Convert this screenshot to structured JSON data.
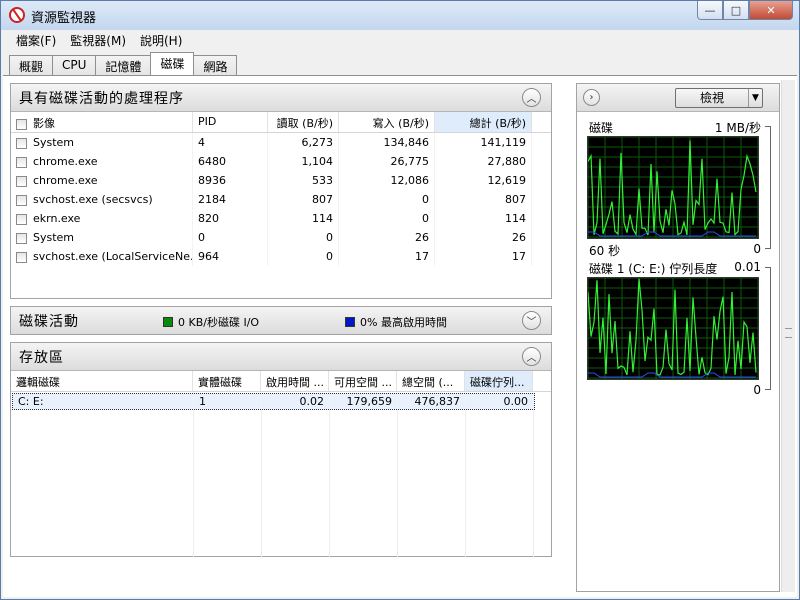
{
  "window": {
    "title": "資源監視器",
    "controls": {
      "minimize": "—",
      "maximize": "□",
      "close": "✕"
    }
  },
  "menu": [
    "檔案(F)",
    "監視器(M)",
    "說明(H)"
  ],
  "tabs": [
    "概觀",
    "CPU",
    "記憶體",
    "磁碟",
    "網路"
  ],
  "active_tab": 3,
  "processes": {
    "title": "具有磁碟活動的處理程序",
    "columns": [
      "影像",
      "PID",
      "讀取 (B/秒)",
      "寫入 (B/秒)",
      "總計 (B/秒)"
    ],
    "rows": [
      [
        "System",
        "4",
        "6,273",
        "134,846",
        "141,119"
      ],
      [
        "chrome.exe",
        "6480",
        "1,104",
        "26,775",
        "27,880"
      ],
      [
        "chrome.exe",
        "8936",
        "533",
        "12,086",
        "12,619"
      ],
      [
        "svchost.exe (secsvcs)",
        "2184",
        "807",
        "0",
        "807"
      ],
      [
        "ekrn.exe",
        "820",
        "114",
        "0",
        "114"
      ],
      [
        "System",
        "0",
        "0",
        "26",
        "26"
      ],
      [
        "svchost.exe (LocalServiceNe...",
        "964",
        "0",
        "17",
        "17"
      ]
    ]
  },
  "disk_activity": {
    "title": "磁碟活動",
    "legend1": "0 KB/秒磁碟 I/O",
    "legend2": "0% 最高啟用時間",
    "color1": "#0a8a0a",
    "color2": "#0018c8"
  },
  "storage": {
    "title": "存放區",
    "columns": [
      "邏輯磁碟",
      "實體磁碟",
      "啟用時間 ...",
      "可用空間 ...",
      "總空間 (...",
      "磁碟佇列..."
    ],
    "rows": [
      [
        "C: E:",
        "1",
        "0.02",
        "179,659",
        "476,837",
        "0.00"
      ]
    ]
  },
  "right": {
    "view_label": "檢視",
    "graph1": {
      "title": "磁碟",
      "scale": "1 MB/秒",
      "time": "60 秒",
      "min": "0"
    },
    "graph2": {
      "title": "磁碟 1 (C: E:) 佇列長度",
      "scale": "0.01",
      "min": "0"
    }
  }
}
